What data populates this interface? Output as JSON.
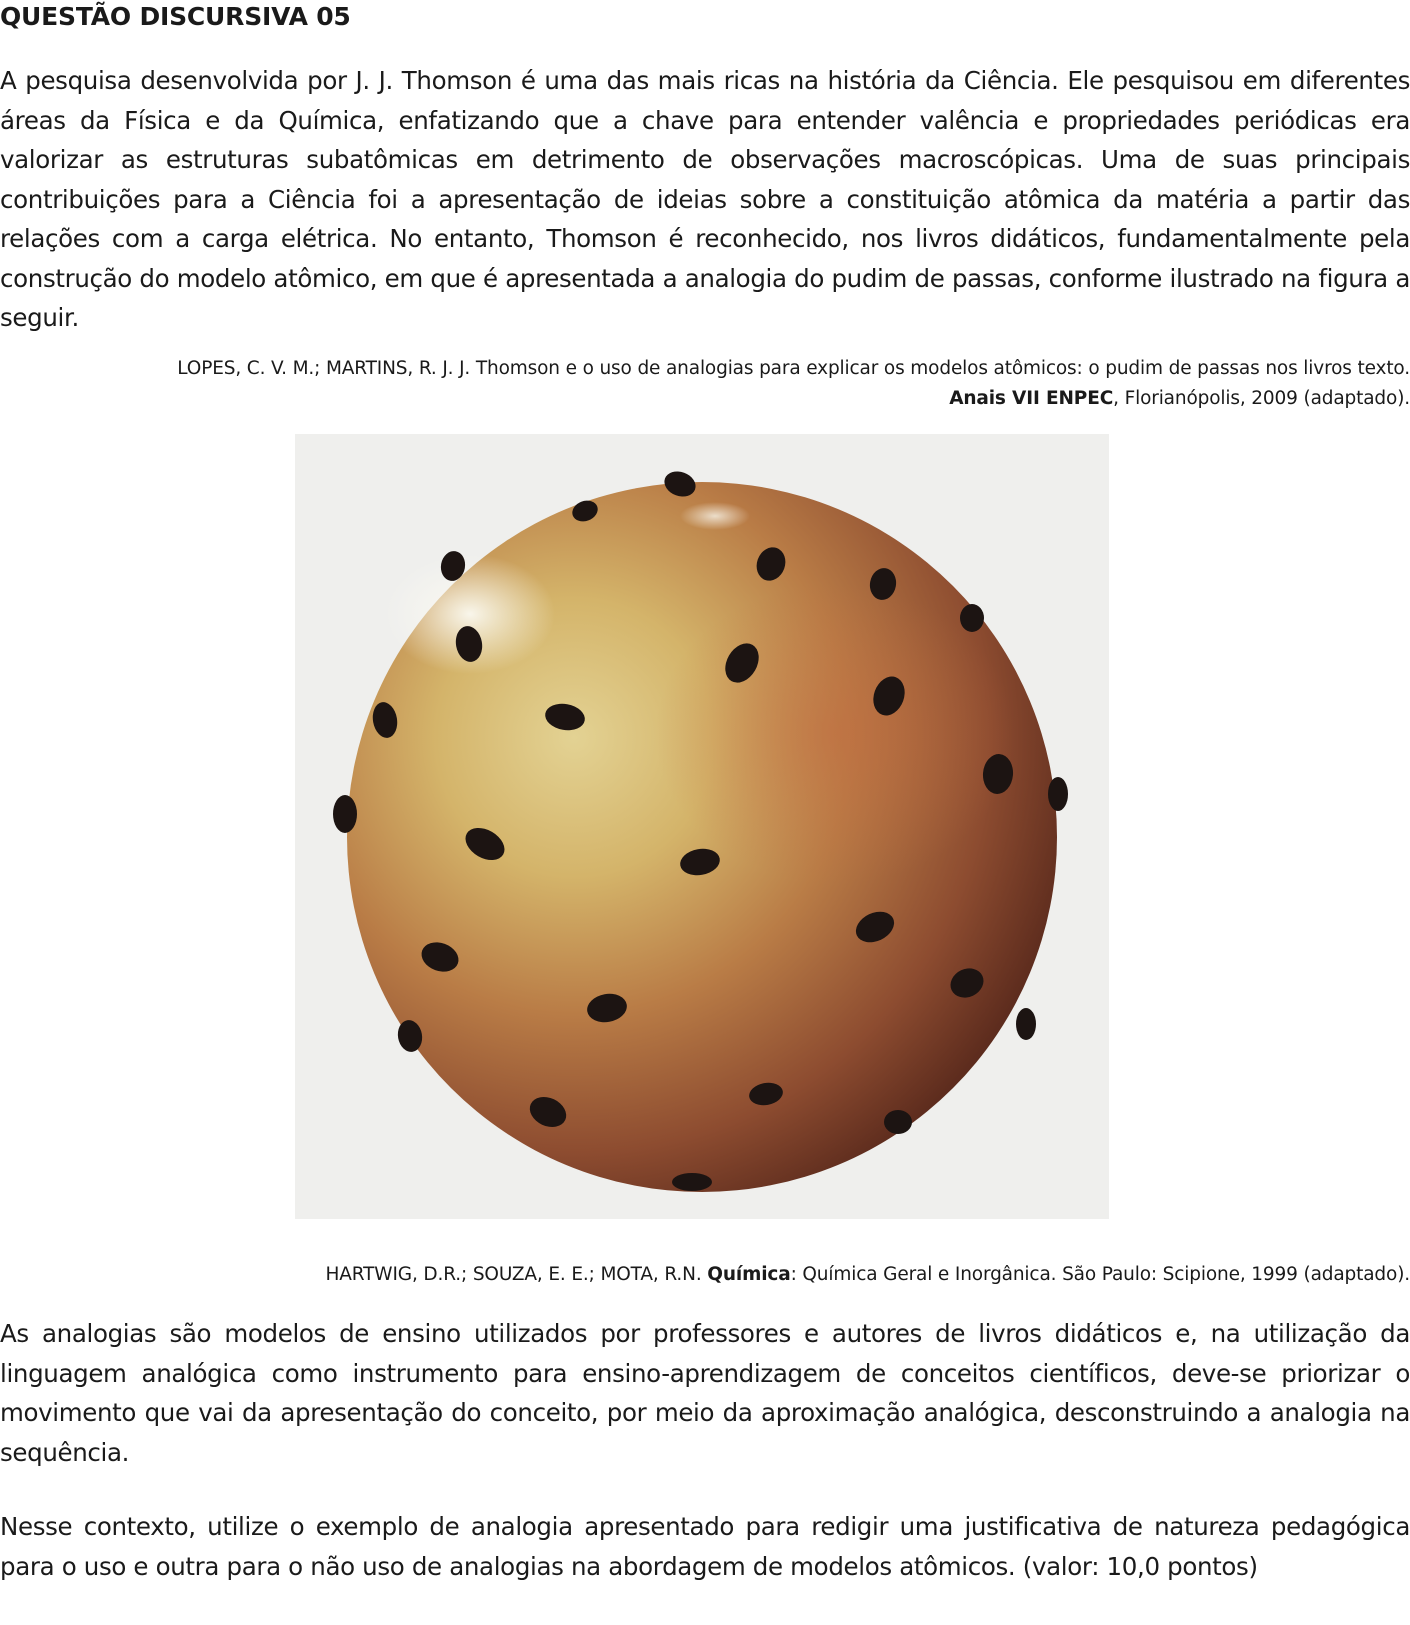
{
  "question": {
    "title": "QUESTÃO DISCURSIVA 05",
    "intro": "A pesquisa desenvolvida por J. J. Thomson é uma das mais ricas na história da Ciência. Ele pesquisou em diferentes áreas da Física e da Química, enfatizando que a chave para entender valência e propriedades periódicas era valorizar as estruturas subatômicas em detrimento de observações macroscópicas. Uma de suas principais contribuições para a Ciência foi a apresentação de ideias sobre a constituição atômica da matéria a partir das relações com a carga elétrica. No entanto, Thomson é reconhecido, nos livros didáticos, fundamentalmente pela construção do modelo atômico, em que é apresentada a analogia do pudim de passas, conforme ilustrado na figura a seguir.",
    "citation1": {
      "line1": "LOPES, C. V. M.; MARTINS, R. J. J. Thomson e o uso de analogias para explicar os modelos atômicos: o pudim de passas nos livros texto.",
      "line2_bold": "Anais VII ENPEC",
      "line2_rest": ", Florianópolis, 2009 (adaptado)."
    },
    "figure": {
      "image_icon": "raisin-pudding-sphere-image"
    },
    "citation2": {
      "before": "HARTWIG, D.R.; SOUZA, E. E.; MOTA, R.N. ",
      "bold": "Química",
      "after": ": Química Geral e Inorgânica. São Paulo: Scipione, 1999 (adaptado)."
    },
    "paragraph2": "As analogias são modelos de ensino utilizados por professores e autores de livros didáticos e, na utilização da linguagem analógica como instrumento para ensino-aprendizagem de conceitos científicos, deve-se priorizar o movimento que vai da apresentação do conceito, por meio da aproximação analógica, desconstruindo a analogia na sequência.",
    "paragraph3": "Nesse contexto, utilize o exemplo de analogia apresentado para redigir uma justificativa de natureza pedagógica para o uso e outra para o não uso de analogias na abordagem de modelos atômicos. (valor: 10,0 pontos)"
  }
}
